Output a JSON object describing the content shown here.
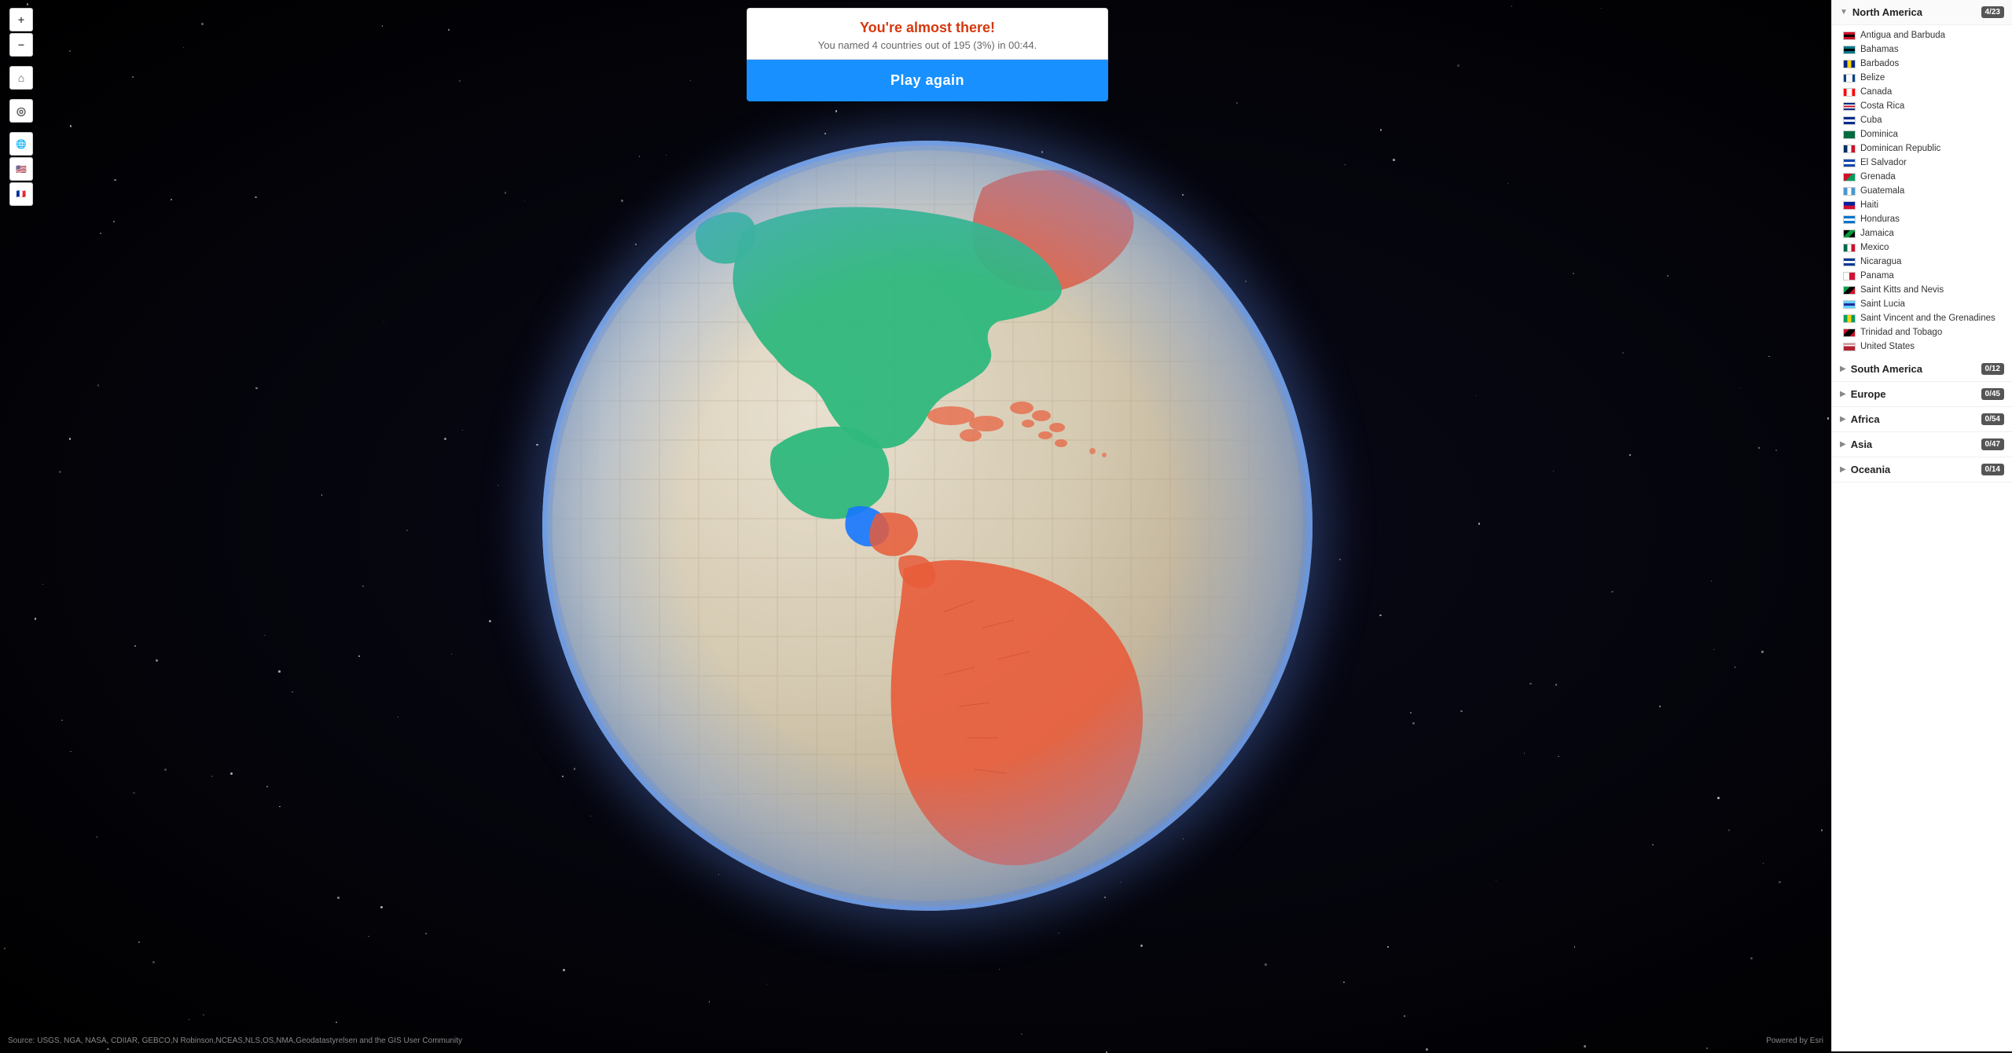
{
  "popup": {
    "title": "You're almost there!",
    "subtitle": "You named 4 countries out of 195 (3%) in 00:44.",
    "button_label": "Play again"
  },
  "source": "Source: USGS, NGA, NASA, CDIIAR, GEBCO,N Robinson,NCEAS,NLS,OS,NMA,Geodatastyrelsen and the GIS User Community",
  "powered_by": "Powered by Esri",
  "controls": {
    "zoom_in": "+",
    "zoom_out": "−",
    "home": "⌂",
    "compass": "◎",
    "globe_icon": "🌐",
    "flag_icon": "🏴"
  },
  "regions": [
    {
      "id": "north-america",
      "name": "North America",
      "score": "4/23",
      "expanded": true,
      "countries": [
        {
          "name": "Antigua and Barbuda",
          "flag_class": "flag-ag"
        },
        {
          "name": "Bahamas",
          "flag_class": "flag-bs"
        },
        {
          "name": "Barbados",
          "flag_class": "flag-bb"
        },
        {
          "name": "Belize",
          "flag_class": "flag-bz"
        },
        {
          "name": "Canada",
          "flag_class": "flag-ca"
        },
        {
          "name": "Costa Rica",
          "flag_class": "flag-cr"
        },
        {
          "name": "Cuba",
          "flag_class": "flag-cu"
        },
        {
          "name": "Dominica",
          "flag_class": "flag-dm"
        },
        {
          "name": "Dominican Republic",
          "flag_class": "flag-do"
        },
        {
          "name": "El Salvador",
          "flag_class": "flag-sv"
        },
        {
          "name": "Grenada",
          "flag_class": "flag-gd"
        },
        {
          "name": "Guatemala",
          "flag_class": "flag-gt"
        },
        {
          "name": "Haiti",
          "flag_class": "flag-ht"
        },
        {
          "name": "Honduras",
          "flag_class": "flag-hn"
        },
        {
          "name": "Jamaica",
          "flag_class": "flag-jm"
        },
        {
          "name": "Mexico",
          "flag_class": "flag-mx"
        },
        {
          "name": "Nicaragua",
          "flag_class": "flag-ni"
        },
        {
          "name": "Panama",
          "flag_class": "flag-pa"
        },
        {
          "name": "Saint Kitts and Nevis",
          "flag_class": "flag-kn"
        },
        {
          "name": "Saint Lucia",
          "flag_class": "flag-lc"
        },
        {
          "name": "Saint Vincent and the Grenadines",
          "flag_class": "flag-vc"
        },
        {
          "name": "Trinidad and Tobago",
          "flag_class": "flag-tt"
        },
        {
          "name": "United States",
          "flag_class": "flag-us"
        }
      ]
    },
    {
      "id": "south-america",
      "name": "South America",
      "score": "0/12",
      "expanded": false,
      "countries": []
    },
    {
      "id": "europe",
      "name": "Europe",
      "score": "0/45",
      "expanded": false,
      "countries": []
    },
    {
      "id": "africa",
      "name": "Africa",
      "score": "0/54",
      "expanded": false,
      "countries": []
    },
    {
      "id": "asia",
      "name": "Asia",
      "score": "0/47",
      "expanded": false,
      "countries": []
    },
    {
      "id": "oceania",
      "name": "Oceania",
      "score": "0/14",
      "expanded": false,
      "countries": []
    }
  ]
}
